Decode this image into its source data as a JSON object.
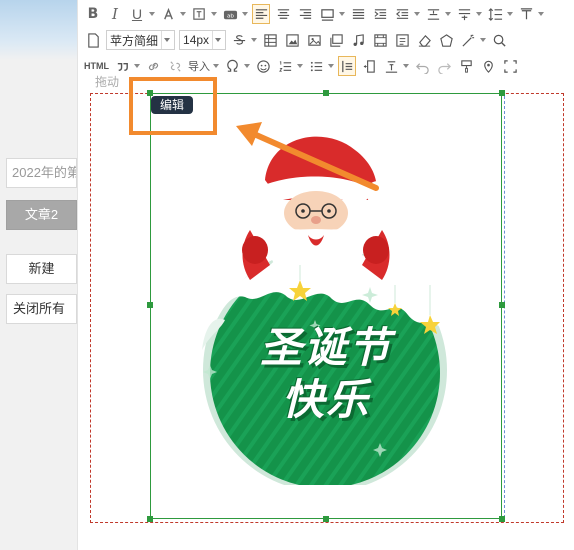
{
  "sidebar": {
    "search_value": "2022年的第",
    "tab_label": "文章2",
    "new_label": "新建",
    "close_all_label": "关闭所有"
  },
  "toolbar": {
    "font_family": "苹方简细",
    "font_size": "14px",
    "html_label": "HTML",
    "import_label": "导入",
    "icons_row1": [
      "bold-icon",
      "italic-icon",
      "underline-icon",
      "font-color-icon",
      "bg-color-icon",
      "highlight-icon",
      "align-left-icon",
      "align-center-icon",
      "align-right-icon",
      "border-icon",
      "align-justify-icon",
      "indent-icon",
      "outdent-icon",
      "spacing-top-icon",
      "spacing-bottom-icon",
      "line-height-icon",
      "clear-format-icon"
    ],
    "icons_row2": [
      "new-doc-icon",
      "strikethrough-icon",
      "table-icon",
      "image-icon",
      "picture-icon",
      "gallery-icon",
      "music-icon",
      "video-icon",
      "attachment-icon",
      "eraser-icon",
      "template-icon",
      "magic-wand-icon",
      "search-replace-icon"
    ],
    "icons_row3": [
      "quote-icon",
      "link-icon",
      "unlink-icon",
      "special-char-icon",
      "emoji-icon",
      "ordered-list-icon",
      "unordered-list-icon",
      "fit-width-icon",
      "insert-col-icon",
      "vertical-align-icon",
      "undo-icon",
      "redo-icon",
      "format-painter-icon",
      "map-icon",
      "fullscreen-icon"
    ]
  },
  "editor": {
    "drag_label": "拖动",
    "edit_tag": "编辑",
    "image_text_line1": "圣诞节",
    "image_text_line2": "快乐",
    "image_description": "christmas-santa-image"
  },
  "colors": {
    "accent_orange": "#f28a2e",
    "selection_green": "#2e9a3e",
    "dashed_red": "#c0392b",
    "xmas_green": "#14934a",
    "santa_red": "#d92b2b",
    "star_yellow": "#f7d23a"
  }
}
